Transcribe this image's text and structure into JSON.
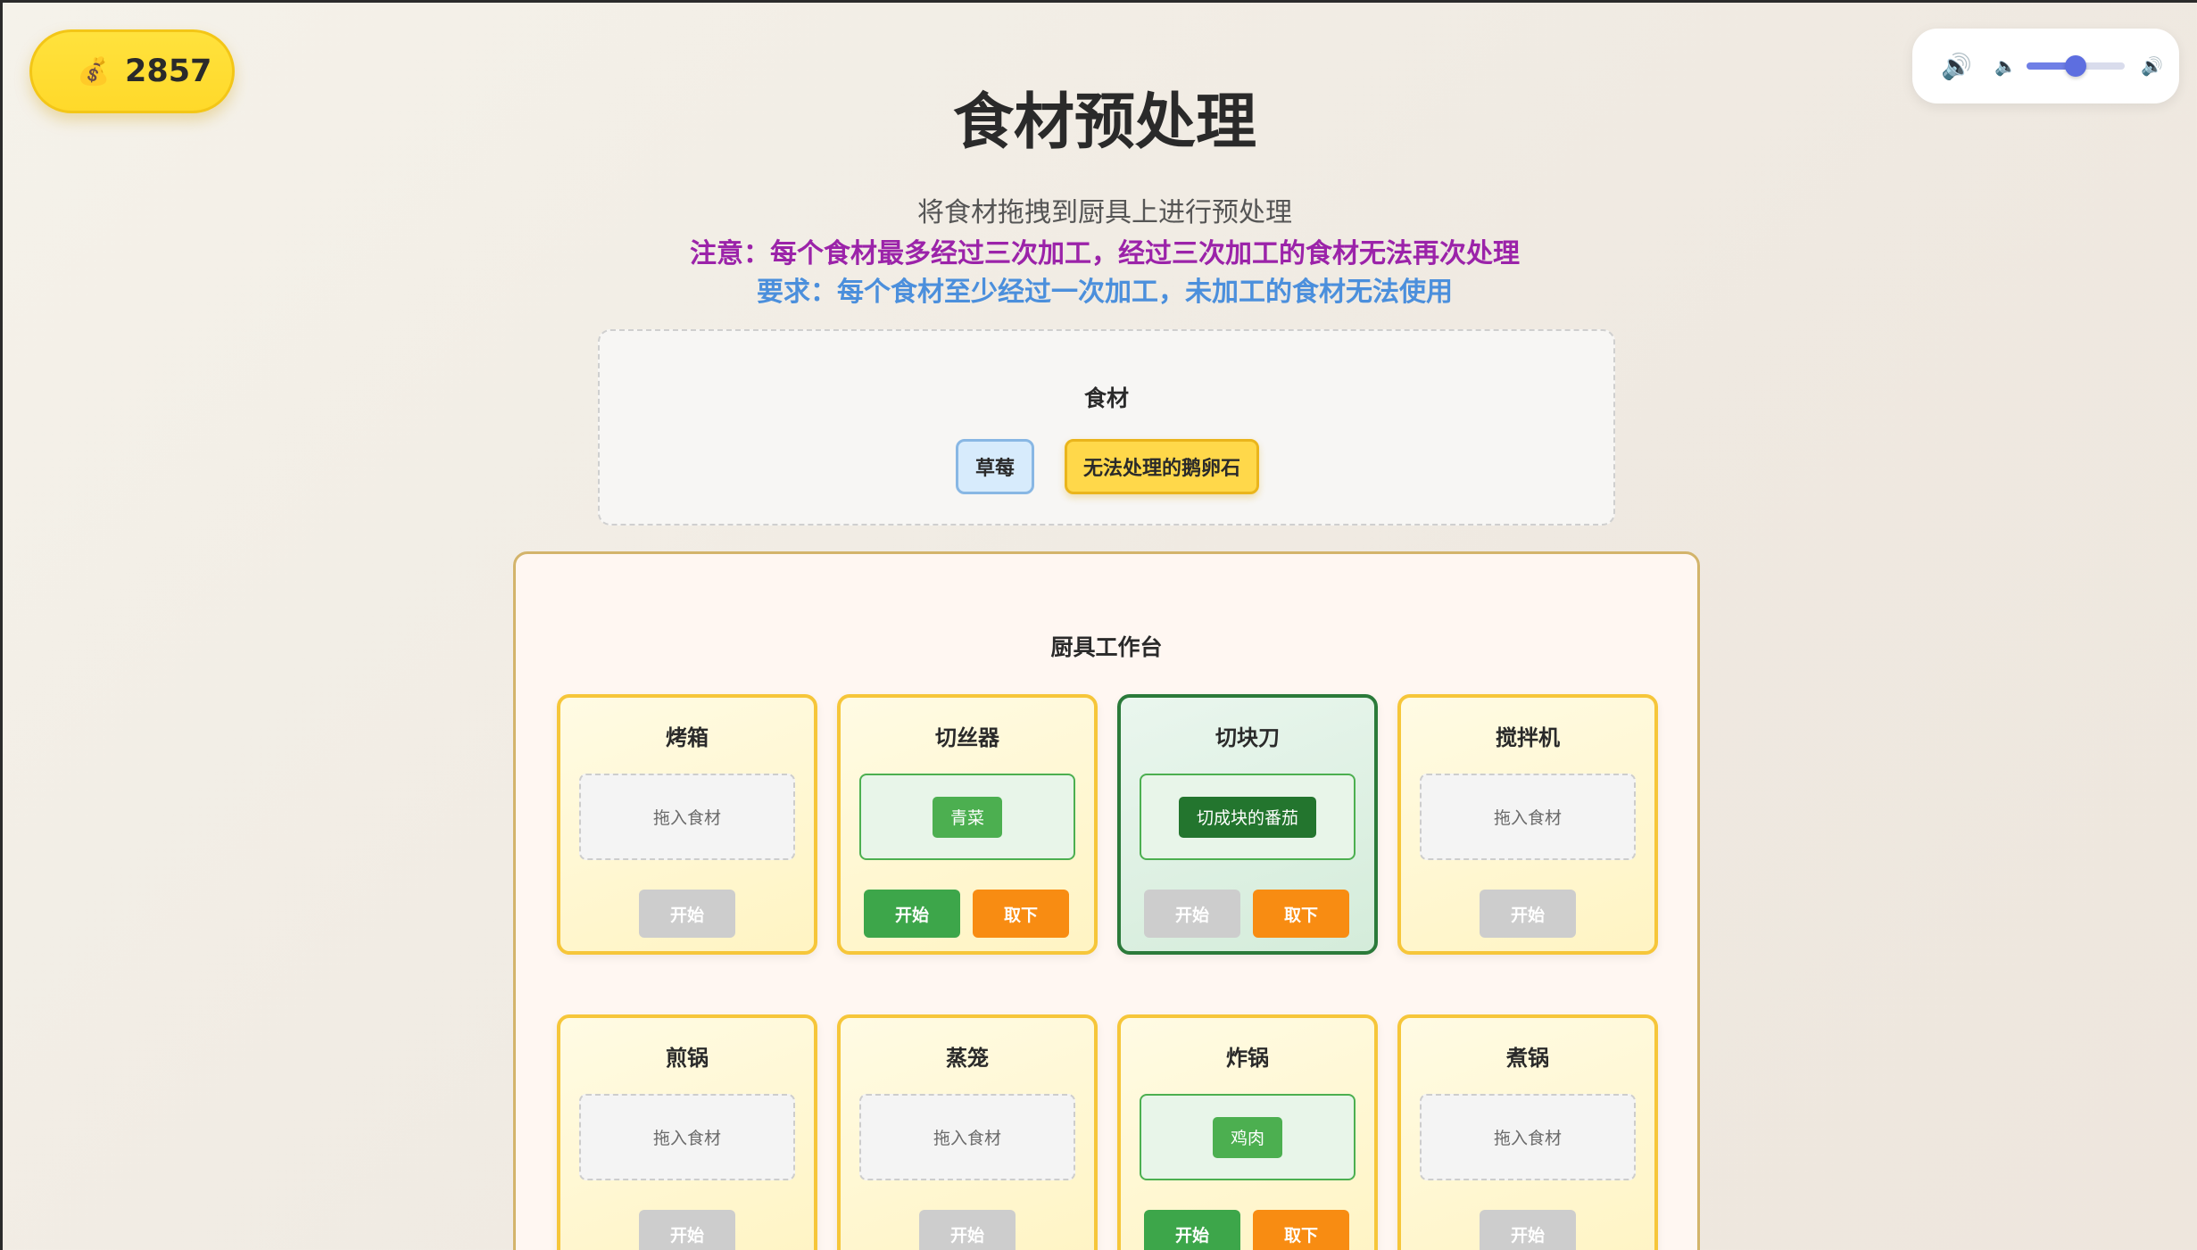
{
  "coins": {
    "icon": "money-bag-icon",
    "value": "2857"
  },
  "volume": {
    "main_icon": "speaker-icon",
    "low_icon": "volume-low-icon",
    "high_icon": "volume-high-icon",
    "level": 0.5
  },
  "header": {
    "title": "食材预处理",
    "subtitle": "将食材拖拽到厨具上进行预处理",
    "note": "注意：每个食材最多经过三次加工，经过三次加工的食材无法再次处理",
    "requirement": "要求：每个食材至少经过一次加工，未加工的食材无法使用"
  },
  "ingredients": {
    "title": "食材",
    "items": [
      {
        "label": "草莓"
      },
      {
        "label": "无法处理的鹅卵石"
      }
    ]
  },
  "workstation": {
    "title": "厨具工作台",
    "tools": [
      {
        "name": "烤箱",
        "placeholder": "拖入食材",
        "start": "开始"
      },
      {
        "name": "切丝器",
        "item": "青菜",
        "start": "开始",
        "remove": "取下"
      },
      {
        "name": "切块刀",
        "item": "切成块的番茄",
        "start": "开始",
        "remove": "取下"
      },
      {
        "name": "搅拌机",
        "placeholder": "拖入食材",
        "start": "开始"
      },
      {
        "name": "煎锅",
        "placeholder": "拖入食材",
        "start": "开始"
      },
      {
        "name": "蒸笼",
        "placeholder": "拖入食材",
        "start": "开始"
      },
      {
        "name": "炸锅",
        "item": "鸡肉",
        "start": "开始",
        "remove": "取下"
      },
      {
        "name": "煮锅",
        "placeholder": "拖入食材",
        "start": "开始"
      }
    ]
  },
  "colors": {
    "accent_yellow": "#ffd92a",
    "note_purple": "#9b23a9",
    "req_blue": "#4b8fdc",
    "start_green": "#3da64a",
    "remove_orange": "#f88c12",
    "active_green": "#2b7a3a"
  }
}
